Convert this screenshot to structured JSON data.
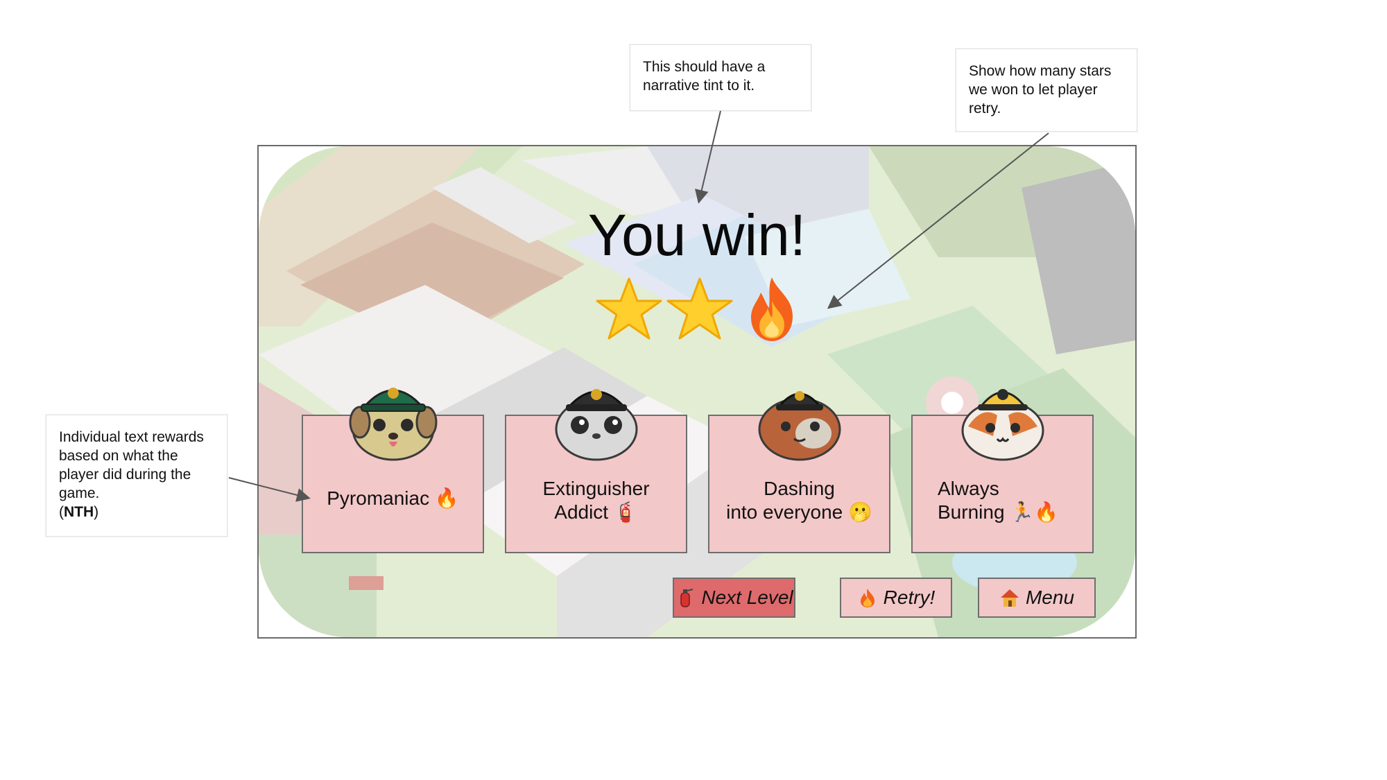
{
  "annotations": {
    "tint_note": "This should have a narrative tint to it.",
    "stars_note": "Show how many stars we won to let player retry.",
    "rewards_note_text": "Individual text rewards based on what the player did during the game.",
    "rewards_note_tag_open": "(",
    "rewards_note_tag": "NTH",
    "rewards_note_tag_close": ")"
  },
  "game": {
    "title": "You win!",
    "stars": {
      "earned": 2,
      "total": 3,
      "icons": [
        "star-icon",
        "star-icon",
        "fire-icon"
      ]
    },
    "rewards": [
      {
        "line1": "Pyromaniac 🔥",
        "line2": "",
        "avatar": "dog-firefighter-avatar"
      },
      {
        "line1": "Extinguisher",
        "line2": "Addict 🧯",
        "avatar": "seal-firefighter-avatar"
      },
      {
        "line1": "Dashing",
        "line2": "into everyone 🫢",
        "avatar": "guinea-pig-firefighter-avatar"
      },
      {
        "line1": "Always",
        "line2": "Burning 🏃🔥",
        "avatar": "cat-firefighter-avatar"
      }
    ],
    "buttons": {
      "next_level": "Next Level",
      "retry": "Retry!",
      "menu": "Menu"
    }
  },
  "colors": {
    "card_fill": "#f3c8c9",
    "primary_button": "#de6a6c",
    "border": "#6e6e6e"
  }
}
